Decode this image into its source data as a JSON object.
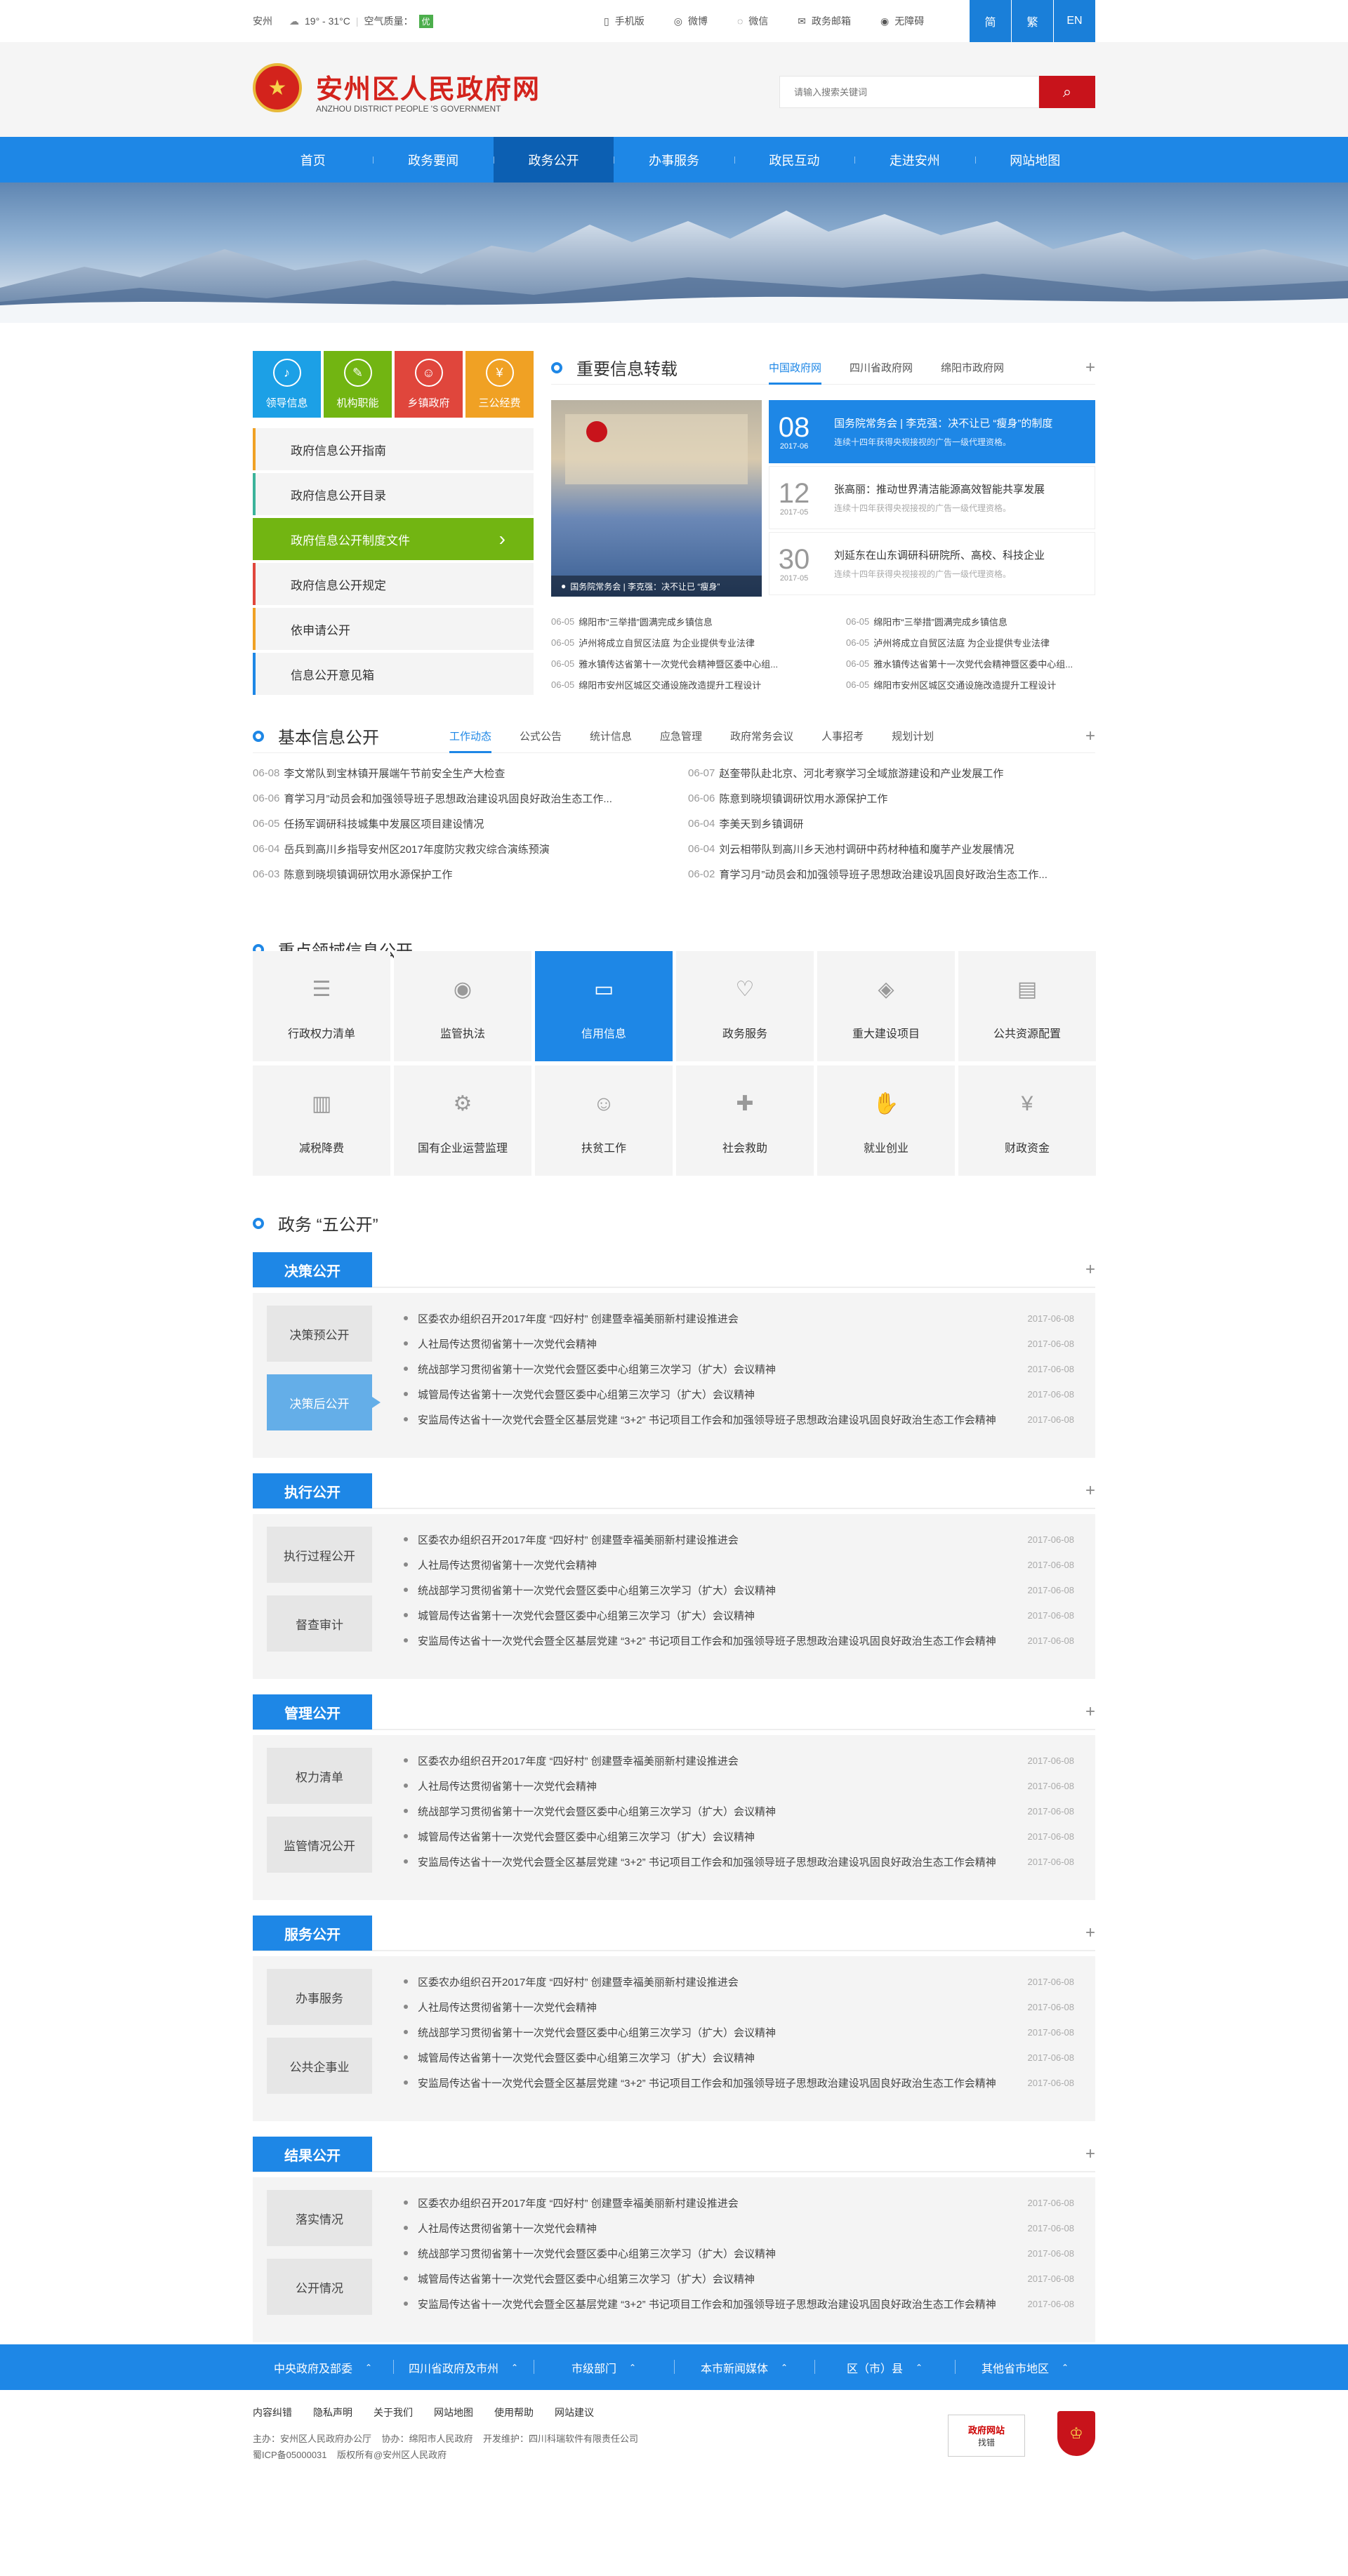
{
  "topbar": {
    "city": "安州",
    "temp": "19° - 31°C",
    "aq_label": "空气质量：",
    "aq_value": "优",
    "links": [
      "手机版",
      "微博",
      "微信",
      "政务邮箱",
      "无障碍"
    ],
    "lang": [
      "简",
      "繁",
      "EN"
    ]
  },
  "header": {
    "emblem_glyph": "★",
    "site_name": "安州区人民政府网",
    "site_name_en": "ANZHOU DISTRICT PEOPLE 'S GOVERNMENT",
    "search_placeholder": "请输入搜索关键词",
    "search_icon": "search-icon"
  },
  "nav": {
    "items": [
      "首页",
      "政务要闻",
      "政务公开",
      "办事服务",
      "政民互动",
      "走进安州",
      "网站地图"
    ],
    "active_index": 2
  },
  "quick": [
    {
      "label": "领导信息",
      "color": "#1ca0e6",
      "icon": "speaker-icon",
      "glyph": "♪"
    },
    {
      "label": "机构职能",
      "color": "#72b512",
      "icon": "document-icon",
      "glyph": "✎"
    },
    {
      "label": "乡镇政府",
      "color": "#e0463c",
      "icon": "people-icon",
      "glyph": "☺"
    },
    {
      "label": "三公经费",
      "color": "#f0a124",
      "icon": "yuan-icon",
      "glyph": "¥"
    }
  ],
  "leftmenu": {
    "items": [
      {
        "label": "政府信息公开指南",
        "color": "#f0a124"
      },
      {
        "label": "政府信息公开目录",
        "color": "#3bb39a"
      },
      {
        "label": "政府信息公开制度文件",
        "color": "#72b512"
      },
      {
        "label": "政府信息公开规定",
        "color": "#e0463c"
      },
      {
        "label": "依申请公开",
        "color": "#f0a124"
      },
      {
        "label": "信息公开意见箱",
        "color": "#1e87e6"
      }
    ],
    "active_index": 2
  },
  "important": {
    "heading": "重要信息转载",
    "tabs": [
      "中国政府网",
      "四川省政府网",
      "绵阳市政府网"
    ],
    "active_tab": 0,
    "photo_caption": "国务院常务会 | 李克强：决不让已 “瘦身”",
    "featured": [
      {
        "day": "08",
        "month": "2017-06",
        "title": "国务院常务会 | 李克强：决不让已 “瘦身”的制度",
        "desc": "连续十四年获得央视接视的广告一级代理资格。",
        "active": true
      },
      {
        "day": "12",
        "month": "2017-05",
        "title": "张高丽：推动世界清洁能源高效智能共享发展",
        "desc": "连续十四年获得央视接视的广告一级代理资格。",
        "active": false
      },
      {
        "day": "30",
        "month": "2017-05",
        "title": "刘延东在山东调研科研院所、高校、科技企业",
        "desc": "连续十四年获得央视接视的广告一级代理资格。",
        "active": false
      }
    ],
    "list_left": [
      {
        "date": "06-05",
        "title": "绵阳市“三举措”圆满完成乡镇信息"
      },
      {
        "date": "06-05",
        "title": "泸州将成立自贸区法庭 为企业提供专业法律"
      },
      {
        "date": "06-05",
        "title": "雅水镇传达省第十一次党代会精神暨区委中心组..."
      },
      {
        "date": "06-05",
        "title": "绵阳市安州区城区交通设施改造提升工程设计"
      }
    ],
    "list_right": [
      {
        "date": "06-05",
        "title": "绵阳市“三举措”圆满完成乡镇信息"
      },
      {
        "date": "06-05",
        "title": "泸州将成立自贸区法庭 为企业提供专业法律"
      },
      {
        "date": "06-05",
        "title": "雅水镇传达省第十一次党代会精神暨区委中心组..."
      },
      {
        "date": "06-05",
        "title": "绵阳市安州区城区交通设施改造提升工程设计"
      }
    ]
  },
  "basic": {
    "heading": "基本信息公开",
    "tabs": [
      "工作动态",
      "公式公告",
      "统计信息",
      "应急管理",
      "政府常务会议",
      "人事招考",
      "规划计划"
    ],
    "active_tab": 0,
    "list_left": [
      {
        "date": "06-08",
        "title": "李文常队到宝林镇开展端午节前安全生产大检查"
      },
      {
        "date": "06-06",
        "title": "育学习月”动员会和加强领导班子思想政治建设巩固良好政治生态工作..."
      },
      {
        "date": "06-05",
        "title": "任扬军调研科技城集中发展区项目建设情况"
      },
      {
        "date": "06-04",
        "title": "岳兵到高川乡指导安州区2017年度防灾救灾综合演练预演"
      },
      {
        "date": "06-03",
        "title": "陈意到晓坝镇调研饮用水源保护工作"
      }
    ],
    "list_right": [
      {
        "date": "06-07",
        "title": "赵奎带队赴北京、河北考察学习全域旅游建设和产业发展工作"
      },
      {
        "date": "06-06",
        "title": "陈意到晓坝镇调研饮用水源保护工作"
      },
      {
        "date": "06-04",
        "title": "李美天到乡镇调研"
      },
      {
        "date": "06-04",
        "title": "刘云相带队到高川乡天池村调研中药材种植和魔芋产业发展情况"
      },
      {
        "date": "06-02",
        "title": "育学习月”动员会和加强领导班子思想政治建设巩固良好政治生态工作..."
      }
    ]
  },
  "key": {
    "heading": "重点领域信息公开",
    "items": [
      {
        "label": "行政权力清单",
        "icon": "list-icon",
        "glyph": "☰"
      },
      {
        "label": "监管执法",
        "icon": "eye-icon",
        "glyph": "◉"
      },
      {
        "label": "信用信息",
        "icon": "credit-card-icon",
        "glyph": "▭"
      },
      {
        "label": "政务服务",
        "icon": "heart-icon",
        "glyph": "♡"
      },
      {
        "label": "重大建设项目",
        "icon": "layers-icon",
        "glyph": "◈"
      },
      {
        "label": "公共资源配置",
        "icon": "form-icon",
        "glyph": "▤"
      },
      {
        "label": "减税降费",
        "icon": "chart-down-icon",
        "glyph": "▥"
      },
      {
        "label": "国有企业运营监理",
        "icon": "gear-icon",
        "glyph": "⚙"
      },
      {
        "label": "扶贫工作",
        "icon": "smile-icon",
        "glyph": "☺"
      },
      {
        "label": "社会救助",
        "icon": "medical-plus-icon",
        "glyph": "✚"
      },
      {
        "label": "就业创业",
        "icon": "handshake-icon",
        "glyph": "✋"
      },
      {
        "label": "财政资金",
        "icon": "yuan-icon",
        "glyph": "¥"
      }
    ],
    "active_index": 2
  },
  "five": {
    "heading": "政务 “五公开”",
    "blocks": [
      {
        "title": "决策公开",
        "subs": [
          "决策预公开",
          "决策后公开"
        ],
        "active_sub": 1
      },
      {
        "title": "执行公开",
        "subs": [
          "执行过程公开",
          "督查审计"
        ],
        "active_sub": -1
      },
      {
        "title": "管理公开",
        "subs": [
          "权力清单",
          "监管情况公开"
        ],
        "active_sub": -1
      },
      {
        "title": "服务公开",
        "subs": [
          "办事服务",
          "公共企事业"
        ],
        "active_sub": -1
      },
      {
        "title": "结果公开",
        "subs": [
          "落实情况",
          "公开情况"
        ],
        "active_sub": -1
      }
    ],
    "items": [
      {
        "title": "区委农办组织召开2017年度 “四好村” 创建暨幸福美丽新村建设推进会",
        "date": "2017-06-08"
      },
      {
        "title": "人社局传达贯彻省第十一次党代会精神",
        "date": "2017-06-08"
      },
      {
        "title": "统战部学习贯彻省第十一次党代会暨区委中心组第三次学习（扩大）会议精神",
        "date": "2017-06-08"
      },
      {
        "title": "城管局传达省第十一次党代会暨区委中心组第三次学习（扩大）会议精神",
        "date": "2017-06-08"
      },
      {
        "title": "安监局传达省十一次党代会暨全区基层党建 “3+2” 书记项目工作会和加强领导班子思想政治建设巩固良好政治生态工作会精神",
        "date": "2017-06-08"
      }
    ]
  },
  "footer_nav": [
    "中央政府及部委",
    "四川省政府及市州",
    "市级部门",
    "本市新闻媒体",
    "区（市）县",
    "其他省市地区"
  ],
  "footer": {
    "links": [
      "内容纠错",
      "隐私声明",
      "关于我们",
      "网站地图",
      "使用帮助",
      "网站建议"
    ],
    "host": "主办：安州区人民政府办公厅",
    "co": "协办：绵阳市人民政府",
    "dev": "开发维护：四川科瑞软件有限责任公司",
    "icp": "蜀ICP备05000031",
    "copyright": "版权所有@安州区人民政府",
    "badge_title": "政府网站",
    "badge_sub": "找错",
    "badge2_glyph": "♔"
  },
  "colors": {
    "primary": "#1e87e6",
    "brand_red": "#c8131b",
    "active_green": "#72b512"
  }
}
